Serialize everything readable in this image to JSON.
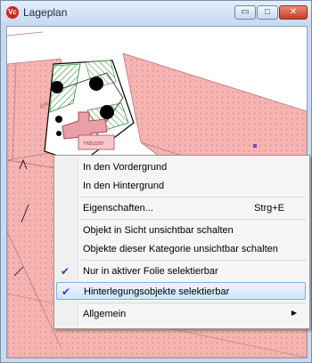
{
  "window": {
    "title": "Lageplan",
    "icon": "app-logo-icon",
    "app_icon_text": "Vc",
    "controls": [
      {
        "name": "minimize-button",
        "glyph": "▭"
      },
      {
        "name": "maximize-button",
        "glyph": "□"
      },
      {
        "name": "close-button",
        "glyph": "✕"
      }
    ]
  },
  "map": {
    "labels": [
      "Häuser",
      "Grü"
    ],
    "colors": {
      "parcel": "#f4aaa8",
      "parcel_line": "#b87b78",
      "hatch": "#2f8a3a",
      "building": "#e8a0a6"
    }
  },
  "context_menu": {
    "items": [
      {
        "label": "In den Vordergrund",
        "shortcut": "",
        "checked": false,
        "submenu": false
      },
      {
        "label": "In den Hintergrund",
        "shortcut": "",
        "checked": false,
        "submenu": false
      },
      {
        "label": "Eigenschaften...",
        "shortcut": "Strg+E",
        "checked": false,
        "submenu": false
      },
      {
        "label": "Objekt in Sicht unsichtbar schalten",
        "shortcut": "",
        "checked": false,
        "submenu": false
      },
      {
        "label": "Objekte dieser Kategorie unsichtbar schalten",
        "shortcut": "",
        "checked": false,
        "submenu": false
      },
      {
        "label": "Nur in aktiver Folie selektierbar",
        "shortcut": "",
        "checked": true,
        "submenu": false
      },
      {
        "label": "Hinterlegungsobjekte selektierbar",
        "shortcut": "",
        "checked": true,
        "submenu": false,
        "highlighted": true
      },
      {
        "label": "Allgemein",
        "shortcut": "",
        "checked": false,
        "submenu": true
      }
    ],
    "check_glyph": "✔",
    "submenu_glyph": "▶"
  }
}
